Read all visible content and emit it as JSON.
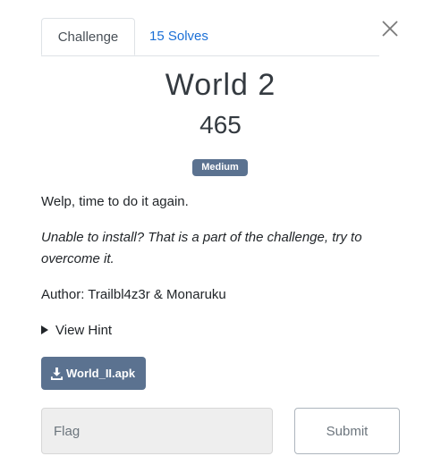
{
  "tabs": [
    {
      "label": "Challenge",
      "active": true
    },
    {
      "label": "15 Solves",
      "active": false
    }
  ],
  "challenge": {
    "name": "World 2",
    "value": "465",
    "difficulty": "Medium",
    "description": "Welp, time to do it again.",
    "note": "Unable to install? That is a part of the challenge, try to overcome it.",
    "author": "Author: Trailbl4z3r & Monaruku"
  },
  "hint": {
    "label": "View Hint"
  },
  "file": {
    "label": "World_II.apk",
    "icon": "download-icon"
  },
  "form": {
    "flag_placeholder": "Flag",
    "flag_value": "",
    "submit_label": "Submit"
  },
  "icons": {
    "close": "close-icon"
  },
  "colors": {
    "accent": "#5b7290",
    "link": "#1b6fd6"
  }
}
